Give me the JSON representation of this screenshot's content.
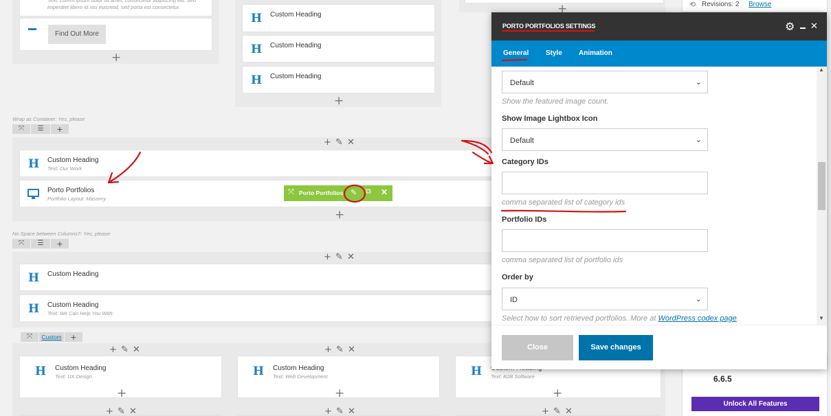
{
  "builder": {
    "top_left_snippet": "Text: Lorem ipsum dolor sit amet, consectetur adipiscing elit. Sed imperdiet libero id nisi euismod, sed porta est consectetur.",
    "find_out_more": "Find Out More",
    "custom_heading": "Custom Heading",
    "row1_meta": "Wrap as Container: Yes, please",
    "row2_meta": "No Space between Columns?: Yes, please",
    "our_work": "Text: Our Work",
    "porto_portfolios": "Porto Portfolios",
    "portfolio_layout": "Portfolio Layout: Masonry",
    "toolbar_label": "Porto Portfolios",
    "help_with": "Text: We Can Help You With:",
    "custom_link": "Custom",
    "ux_design": "Text: UX Design",
    "web_development": "Text: Web Development",
    "b2b_software": "Text: B2B Software"
  },
  "sidebar": {
    "revisions_label": "Revisions: 2",
    "browse_link": "Browse",
    "version": "6.6.5",
    "unlock_button": "Unlock All Features"
  },
  "modal": {
    "title": "PORTO PORTFOLIOS SETTINGS",
    "tabs": [
      "General",
      "Style",
      "Animation"
    ],
    "active_tab": "General",
    "featured_select_value": "Default",
    "featured_help": "Show the featured image count.",
    "lightbox_label": "Show Image Lightbox Icon",
    "lightbox_value": "Default",
    "category_label": "Category IDs",
    "category_value": "",
    "category_help": "comma separated list of category ids",
    "portfolio_label": "Portfolio IDs",
    "portfolio_value": "",
    "portfolio_help": "comma separated list of portfolio ids",
    "orderby_label": "Order by",
    "orderby_value": "ID",
    "orderby_help_prefix": "Select how to sort retrieved portfolios. More at",
    "orderby_help_link": "WordPress codex page",
    "orderby_help_suffix": ".",
    "close_button": "Close",
    "save_button": "Save changes"
  },
  "colors": {
    "accent_blue": "#0088cc",
    "header_dark": "#333333",
    "toolbar_green": "#8dc63f",
    "save_blue": "#0073aa",
    "annotation_red": "#d01418",
    "unlock_purple": "#5b2db0"
  },
  "icons": [
    "heading-icon",
    "monitor-icon",
    "gear-icon",
    "minimize-icon",
    "close-icon",
    "move-icon",
    "pencil-icon",
    "clone-icon",
    "delete-icon",
    "plus-icon",
    "history-icon",
    "chevron-down-icon"
  ]
}
